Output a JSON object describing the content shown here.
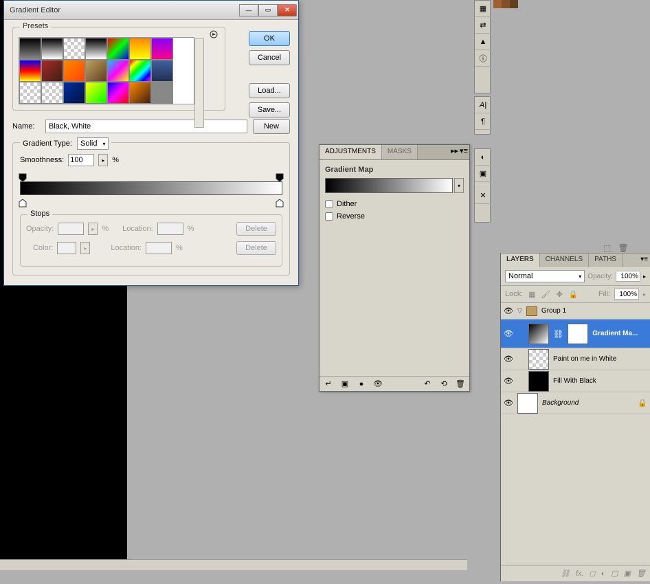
{
  "dialog": {
    "title": "Gradient Editor",
    "presets_legend": "Presets",
    "buttons": {
      "ok": "OK",
      "cancel": "Cancel",
      "load": "Load...",
      "save": "Save...",
      "new": "New"
    },
    "name_label": "Name:",
    "name_value": "Black, White",
    "grad_type_label": "Gradient Type:",
    "grad_type_value": "Solid",
    "smooth_label": "Smoothness:",
    "smooth_value": "100",
    "percent": "%",
    "stops_legend": "Stops",
    "opacity_label": "Opacity:",
    "location_label": "Location:",
    "color_label": "Color:",
    "delete_label": "Delete"
  },
  "adjustments": {
    "tab1": "ADJUSTMENTS",
    "tab2": "MASKS",
    "title": "Gradient Map",
    "dither": "Dither",
    "reverse": "Reverse"
  },
  "layers": {
    "tab_layers": "LAYERS",
    "tab_channels": "CHANNELS",
    "tab_paths": "PATHS",
    "blend_mode": "Normal",
    "opacity_label": "Opacity:",
    "opacity_value": "100%",
    "lock_label": "Lock:",
    "fill_label": "Fill:",
    "fill_value": "100%",
    "group1": "Group 1",
    "gradmap": "Gradient Ma...",
    "paint": "Paint on me in White",
    "fillblack": "Fill With Black",
    "background": "Background"
  },
  "preset_swatches": [
    "linear-gradient(#000,#888)",
    "linear-gradient(#000,#fff)",
    "repeating-conic-gradient(#ccc 0 25%, #fff 0 50%) 0 0/10px 10px",
    "linear-gradient(#000,#fff)",
    "linear-gradient(135deg,#f00,#0f0,#00f)",
    "linear-gradient(#f80,#ff0)",
    "linear-gradient(#80f,#f08)",
    "linear-gradient(#00f,#f00,#ff0)",
    "linear-gradient(135deg,#a52a2a,#402010)",
    "linear-gradient(135deg,#f80,#f40)",
    "linear-gradient(135deg,#c0a060,#604020)",
    "linear-gradient(135deg,#0cf,#f0f,#ff0)",
    "linear-gradient(135deg,#f00,#ff0,#0f0,#0ff,#00f,#f0f)",
    "linear-gradient(#4060a0,#203050)",
    "repeating-conic-gradient(#ccc 0 25%, #fff 0 50%) 0 0/10px 10px",
    "repeating-conic-gradient(#ccc 0 25%, #fff 0 50%) 0 0/10px 10px",
    "linear-gradient(135deg,#0030a0,#001040)",
    "linear-gradient(135deg,#ff0,#0f0)",
    "linear-gradient(135deg,#00f,#f0f,#f00)",
    "linear-gradient(135deg,#f80,#402010)",
    "#888"
  ]
}
